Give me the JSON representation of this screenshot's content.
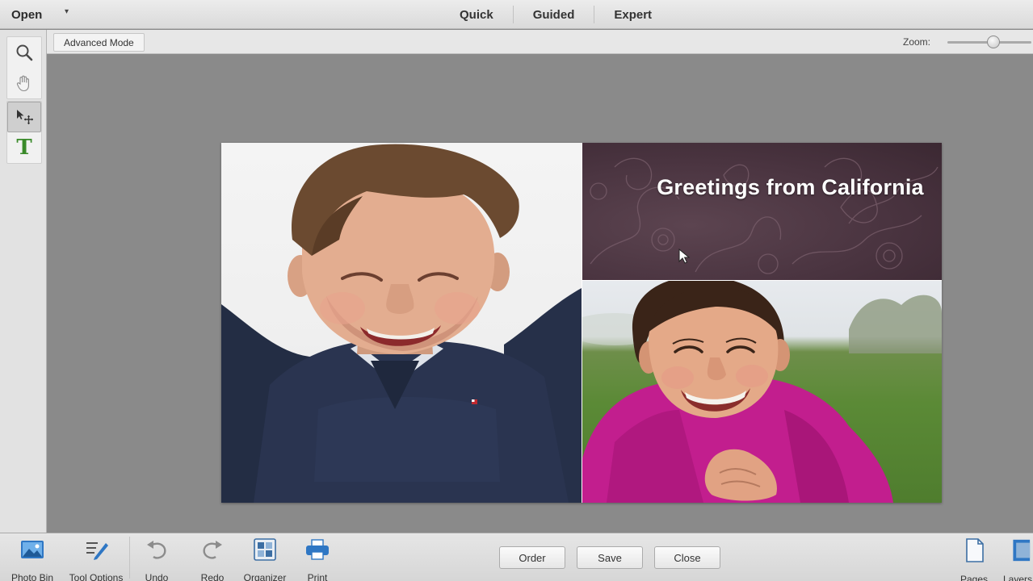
{
  "topbar": {
    "open_label": "Open",
    "modes": [
      "Quick",
      "Guided",
      "Expert"
    ]
  },
  "subbar": {
    "advanced_mode_label": "Advanced Mode",
    "zoom_label": "Zoom:",
    "zoom_level": 0.55
  },
  "toolbox": {
    "tools": [
      "zoom-icon",
      "hand-icon",
      "move-icon",
      "type-icon"
    ],
    "type_tool_glyph": "T",
    "active_tool": "move-icon"
  },
  "canvas": {
    "banner_title": "Greetings from California"
  },
  "bottombar": {
    "photo_bin_label": "Photo Bin",
    "tool_options_label": "Tool Options",
    "undo_label": "Undo",
    "redo_label": "Redo",
    "organizer_label": "Organizer",
    "print_label": "Print",
    "order_label": "Order",
    "save_label": "Save",
    "close_label": "Close",
    "pages_label": "Pages",
    "layers_label": "Layers"
  },
  "colors": {
    "banner_bg": "#4a3440",
    "accent_type": "#3a8a2a",
    "canvas_bg": "#8a8a8a"
  }
}
